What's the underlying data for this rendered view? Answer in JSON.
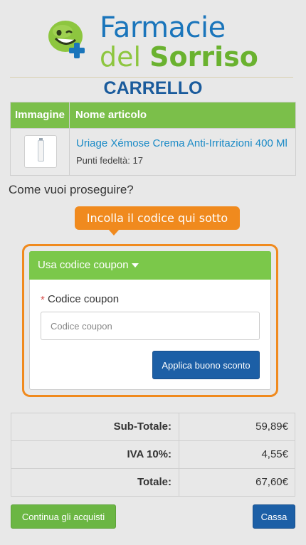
{
  "brand": {
    "line1": "Farmacie",
    "line2_a": "del",
    "line2_b": "Sorriso",
    "logo_icon": "smiley-plus-icon",
    "colors": {
      "blue": "#1a75bb",
      "green": "#6ab22f"
    }
  },
  "page_title": "CARRELLO",
  "cart": {
    "columns": [
      "Immagine",
      "Nome articolo"
    ],
    "items": [
      {
        "name": "Uriage Xémose Crema Anti-Irritazioni 400 Ml",
        "points": "Punti fedeltà: 17",
        "thumb_icon": "product-tube-icon"
      }
    ]
  },
  "proceed_question": "Come vuoi proseguire?",
  "hint": "Incolla il codice qui sotto",
  "coupon": {
    "header": "Usa codice coupon",
    "required_mark": "*",
    "label": "Codice coupon",
    "placeholder": "Codice coupon",
    "value": "",
    "apply_label": "Applica buono sconto"
  },
  "totals": [
    {
      "label": "Sub-Totale:",
      "value": "59,89€"
    },
    {
      "label": "IVA 10%:",
      "value": "4,55€"
    },
    {
      "label": "Totale:",
      "value": "67,60€"
    }
  ],
  "actions": {
    "continue_label": "Continua gli acquisti",
    "checkout_label": "Cassa"
  },
  "accent_colors": {
    "green": "#7bbf4a",
    "blue": "#1c5fa6",
    "orange": "#f08a1e"
  }
}
